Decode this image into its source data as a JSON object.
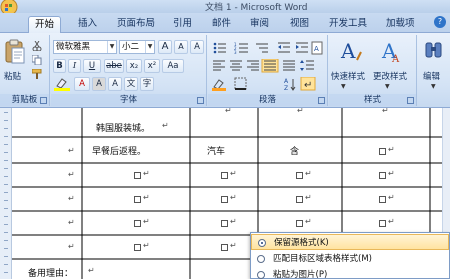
{
  "window": {
    "title": "文档 1 - Microsoft Word"
  },
  "tabs": [
    {
      "label": "开始",
      "active": true
    },
    {
      "label": "插入"
    },
    {
      "label": "页面布局"
    },
    {
      "label": "引用"
    },
    {
      "label": "邮件"
    },
    {
      "label": "审阅"
    },
    {
      "label": "视图"
    },
    {
      "label": "开发工具"
    },
    {
      "label": "加载项"
    }
  ],
  "ribbon": {
    "clipboard": {
      "label": "剪贴板",
      "paste_label": "粘贴"
    },
    "font": {
      "label": "字体",
      "font_name": "微软雅黑",
      "font_size": "小二",
      "bold": "B",
      "italic": "I",
      "underline": "U",
      "strike": "abe",
      "subscript": "x₂",
      "superscript": "x²",
      "aa": "Aa",
      "font_color": "A",
      "clear": "A"
    },
    "paragraph": {
      "label": "段落"
    },
    "styles": {
      "label": "样式",
      "quick_styles": "快速样式",
      "change_styles": "更改样式"
    },
    "editing": {
      "label": "编辑"
    }
  },
  "table": {
    "rows": [
      {
        "c1": "韩国服装城。",
        "c1_suffix": "↵",
        "c2": "↵",
        "c3": "↵",
        "c4": "↵"
      },
      {
        "c0": "↵",
        "c1": "早餐后返程。",
        "c2": "汽车",
        "c3": "含",
        "c4": "↵"
      },
      {
        "c0": "↵"
      },
      {
        "c0": "↵"
      },
      {
        "c0": "↵"
      },
      {
        "c0": "↵"
      },
      {
        "c0": "备用理由：",
        "c1": "↵"
      }
    ],
    "checkbox_mark": "↵"
  },
  "paste_popup": {
    "items": [
      {
        "label": "保留源格式(K)",
        "selected": true
      },
      {
        "label": "匹配目标区域表格样式(M)",
        "selected": false
      },
      {
        "label": "粘贴为图片(P)",
        "selected": false
      }
    ]
  },
  "colors": {
    "ribbon_bg": "#d4e3f5",
    "accent_blue": "#2f74c9",
    "highlight": "#ffe3a0"
  }
}
